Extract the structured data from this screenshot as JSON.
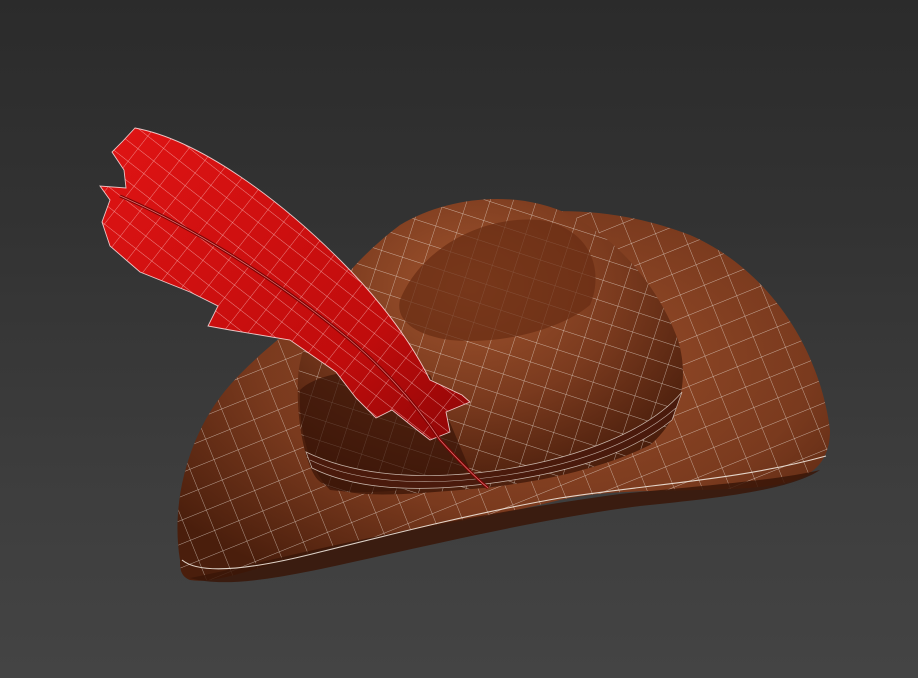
{
  "viewport": {
    "background_top": "#2b2b2b",
    "background_bottom": "#444444"
  },
  "model": {
    "object": "hat",
    "colors": {
      "hat_body": "#7a3a1e",
      "hat_shadow": "#3a1608",
      "hat_highlight": "#9a4e2a",
      "band": "#4a1a0c",
      "feather": "#d40e0e",
      "feather_shadow": "#8e0606",
      "wireframe": "#e8e0d8"
    }
  }
}
